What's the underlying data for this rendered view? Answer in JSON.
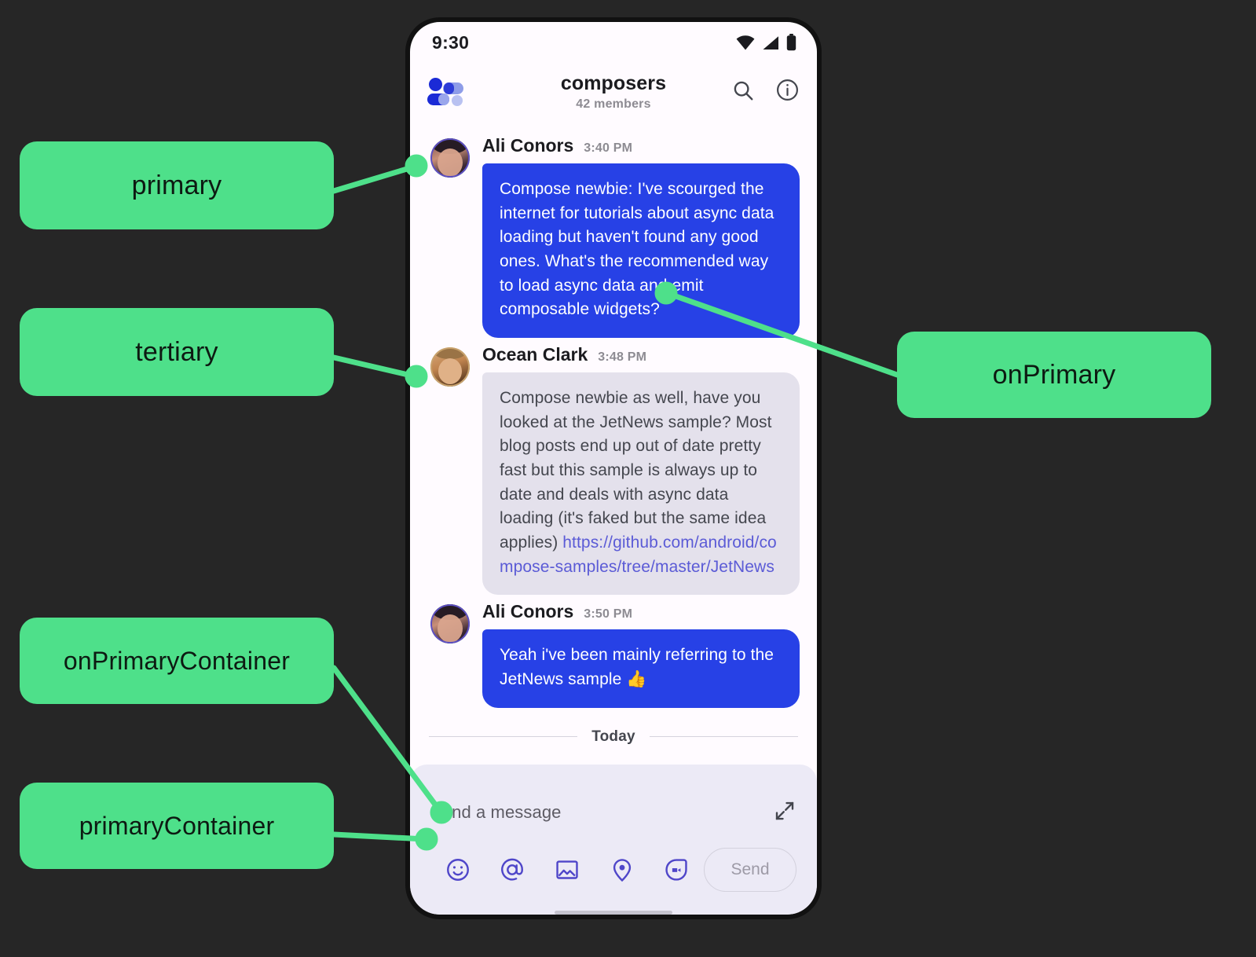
{
  "annotations": [
    {
      "id": "primary",
      "label": "primary"
    },
    {
      "id": "tertiary",
      "label": "tertiary"
    },
    {
      "id": "onPrimaryContainer",
      "label": "onPrimaryContainer"
    },
    {
      "id": "primaryContainer",
      "label": "primaryContainer"
    },
    {
      "id": "onPrimary",
      "label": "onPrimary"
    }
  ],
  "colors": {
    "annotation_chip": "#4ee08a",
    "annotation_text": "#0d1a12",
    "backdrop": "#262626",
    "primary_bubble": "#2741e6",
    "on_primary_text": "#ffffff",
    "primary_container": "#eceaf6",
    "on_primary_container": "#5d5b64",
    "received_bubble": "#e4e1ec",
    "link": "#5b5bd6",
    "icon_indigo": "#4f46c9"
  },
  "phone": {
    "status_bar": {
      "time": "9:30",
      "icons": [
        "wifi-icon",
        "cellular-signal-icon",
        "battery-icon"
      ]
    },
    "app_bar": {
      "logo_icon": "composers-logo-icon",
      "title": "composers",
      "subtitle": "42 members",
      "search_icon": "search-icon",
      "info_icon": "info-icon"
    },
    "messages": [
      {
        "author": "Ali Conors",
        "time": "3:40 PM",
        "avatar": "ali-conors-avatar",
        "side": "sent",
        "text": "Compose newbie: I've scourged the internet for tutorials about async data loading but haven't found any good ones. What's the recommended way to load async data and emit composable widgets?",
        "link": null
      },
      {
        "author": "Ocean Clark",
        "time": "3:48 PM",
        "avatar": "ocean-clark-avatar",
        "side": "received",
        "text": "Compose newbie as well, have you looked at the JetNews sample? Most blog posts end up out of date pretty fast but this sample is always up to date and deals with async data loading (it's faked but the same idea applies) ",
        "link": "https://github.com/android/compose-samples/tree/master/JetNews"
      },
      {
        "author": "Ali Conors",
        "time": "3:50 PM",
        "avatar": "ali-conors-avatar",
        "side": "sent",
        "text": "Yeah i've been mainly referring to the JetNews sample 👍",
        "link": null
      }
    ],
    "divider": {
      "label": "Today"
    },
    "input": {
      "placeholder": "Send a message",
      "expand_icon": "expand-icon",
      "actions": [
        {
          "icon": "emoji-icon"
        },
        {
          "icon": "mention-icon"
        },
        {
          "icon": "image-icon"
        },
        {
          "icon": "location-pin-icon"
        },
        {
          "icon": "video-camera-icon"
        }
      ],
      "send_label": "Send"
    }
  }
}
